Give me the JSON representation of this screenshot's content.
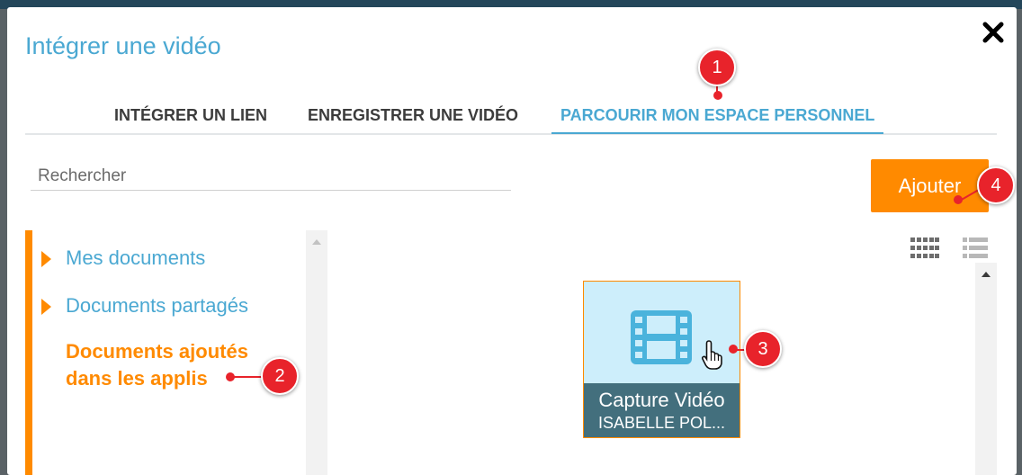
{
  "dialog": {
    "title": "Intégrer une vidéo",
    "close_icon": "close-icon"
  },
  "tabs": [
    {
      "label": "INTÉGRER UN LIEN",
      "active": false
    },
    {
      "label": "ENREGISTRER UNE VIDÉO",
      "active": false
    },
    {
      "label": "PARCOURIR MON ESPACE PERSONNEL",
      "active": true
    }
  ],
  "search": {
    "placeholder": "Rechercher",
    "value": ""
  },
  "add_button": {
    "label": "Ajouter"
  },
  "folders": [
    {
      "label": "Mes documents",
      "expandable": true
    },
    {
      "label": "Documents partagés",
      "expandable": true
    },
    {
      "label": "Documents ajoutés dans les applis",
      "expandable": false,
      "selected": true
    }
  ],
  "view_modes": [
    {
      "icon": "grid-view-icon",
      "active": true
    },
    {
      "icon": "list-view-icon",
      "active": false
    }
  ],
  "files": [
    {
      "name": "Capture Vidéo",
      "owner": "ISABELLE POL...",
      "icon": "film-icon",
      "selected": true
    }
  ],
  "annotations": [
    "1",
    "2",
    "3",
    "4"
  ],
  "colors": {
    "accent_blue": "#4aa8d2",
    "accent_orange": "#ff8a00",
    "marker_red": "#e8232b",
    "caption_bg": "#436f7d",
    "card_bg": "#cdeefb"
  }
}
